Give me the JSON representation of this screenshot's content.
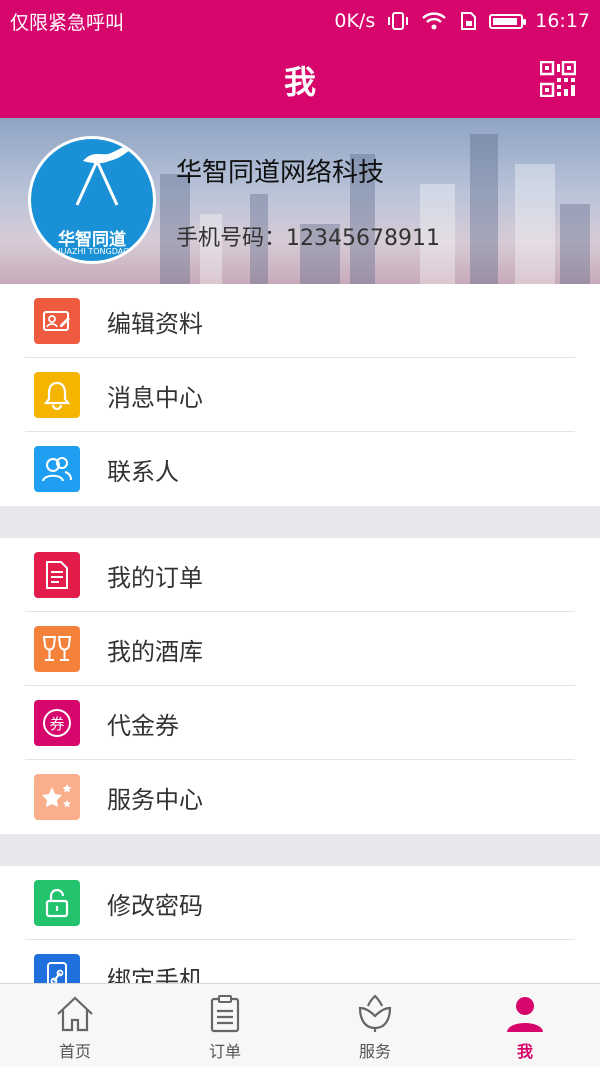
{
  "status_bar": {
    "carrier": "仅限紧急呼叫",
    "network_speed": "0K/s",
    "time": "16:17",
    "battery_level": 0.9
  },
  "header": {
    "title": "我"
  },
  "profile": {
    "company": "华智同道网络科技",
    "phone": "手机号码：12345678911",
    "avatar_brand": "华智同道",
    "avatar_brand_en": "HUAZHI TONGDAO"
  },
  "menu_groups": [
    {
      "items": [
        {
          "label": "编辑资料",
          "icon": "profile-card-icon",
          "color": "#ee5b3f"
        },
        {
          "label": "消息中心",
          "icon": "bell-icon",
          "color": "#f5b400"
        },
        {
          "label": "联系人",
          "icon": "contacts-icon",
          "color": "#1e9ff2"
        }
      ]
    },
    {
      "items": [
        {
          "label": "我的订单",
          "icon": "order-list-icon",
          "color": "#e21c4b"
        },
        {
          "label": "我的酒库",
          "icon": "wine-glasses-icon",
          "color": "#f5823b"
        },
        {
          "label": "代金券",
          "icon": "voucher-icon",
          "color": "#d6066c"
        },
        {
          "label": "服务中心",
          "icon": "stars-icon",
          "color": "#fbae8b"
        }
      ]
    },
    {
      "items": [
        {
          "label": "修改密码",
          "icon": "unlock-icon",
          "color": "#22c36c"
        },
        {
          "label": "绑定手机",
          "icon": "phone-link-icon",
          "color": "#1f6fdd"
        }
      ]
    }
  ],
  "tabbar": {
    "tabs": [
      {
        "label": "首页",
        "icon": "home-icon"
      },
      {
        "label": "订单",
        "icon": "clipboard-icon"
      },
      {
        "label": "服务",
        "icon": "flower-icon"
      },
      {
        "label": "我",
        "icon": "person-icon",
        "active": true
      }
    ],
    "active_color": "#d6066c"
  }
}
